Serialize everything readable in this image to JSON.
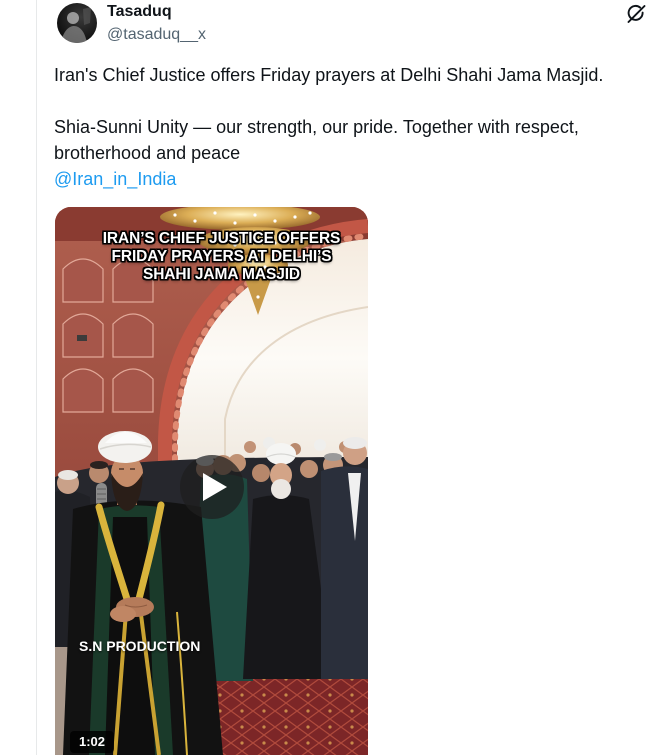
{
  "colors": {
    "text": "#0f1419",
    "secondary": "#536471",
    "link": "#1d9bf0",
    "border": "#e7e9ea",
    "background": "#ffffff"
  },
  "author": {
    "avatar_icon": "avatar-image",
    "name": "Tasaduq",
    "handle": "@tasaduq__x"
  },
  "header": {
    "action_icon": "grok-icon"
  },
  "tweet": {
    "text_paragraphs": [
      "Iran's Chief Justice offers Friday prayers at Delhi Shahi Jama Masjid.",
      "Shia-Sunni Unity — our strength, our pride. Together with respect, brotherhood and peace"
    ],
    "mention": "@Iran_in_India"
  },
  "media": {
    "type": "video",
    "overlay_title": [
      "IRAN’S CHIEF JUSTICE OFFERS",
      "FRIDAY PRAYERS AT DELHI’S",
      "SHAHI JAMA MASJID"
    ],
    "watermark": "S.N PRODUCTION",
    "play_icon": "play-icon",
    "duration": "1:02"
  }
}
